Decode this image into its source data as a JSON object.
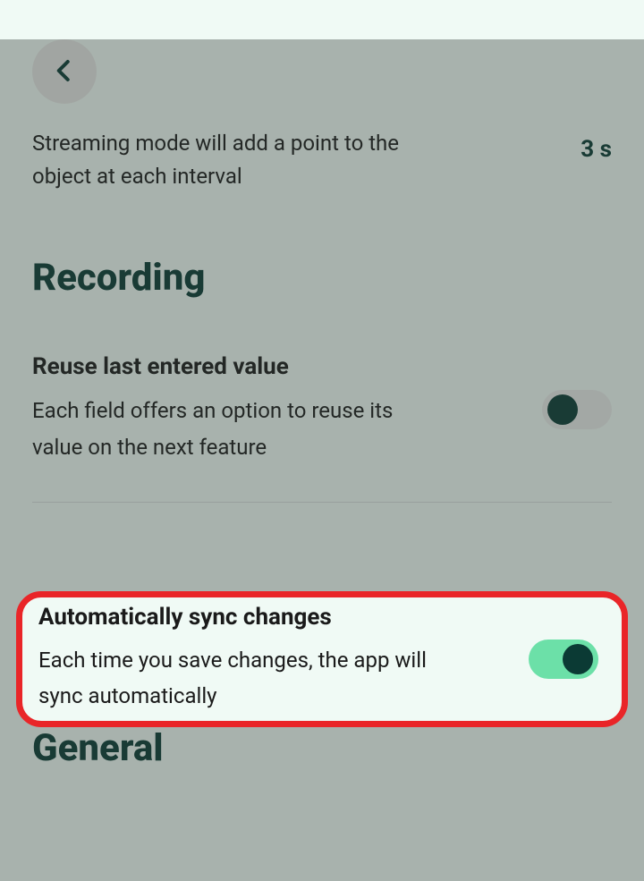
{
  "streaming": {
    "desc": "Streaming mode will add a point to the object at each interval",
    "value": "3 s"
  },
  "sections": {
    "recording": "Recording",
    "general": "General"
  },
  "settings": {
    "reuse": {
      "title": "Reuse last entered value",
      "desc": "Each field offers an option to reuse its value on the next feature"
    },
    "autosync": {
      "title": "Automatically sync changes",
      "desc": "Each time you save changes, the app will sync automatically"
    }
  }
}
